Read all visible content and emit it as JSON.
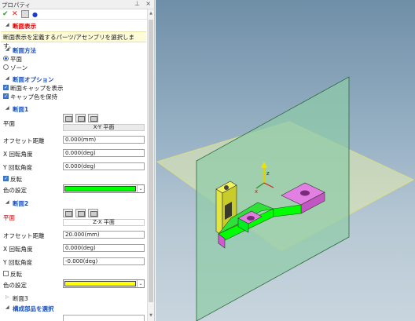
{
  "panel": {
    "title": "プロパティ",
    "pin_icon": "pin-icon",
    "close_icon": "close-icon",
    "toolbar": {
      "ok": "✔",
      "cancel": "✕",
      "dot": "●"
    }
  },
  "section_display": {
    "label": "断面表示",
    "description": "断面表示を定義するパーツ/アセンブリを選択します。"
  },
  "section_method": {
    "label": "断面方法",
    "options": [
      "平面",
      "ゾーン"
    ],
    "selected": "平面"
  },
  "section_options": {
    "label": "断面オプション",
    "show_cap": "断面キャップを表示",
    "keep_cap_color": "キャップ色を保持"
  },
  "section1": {
    "label": "断面1",
    "plane_label": "平面",
    "plane_value": "X-Y 平面",
    "offset_label": "オフセット距離",
    "offset_value": "0.000(mm)",
    "xrot_label": "X 回転角度",
    "xrot_value": "0.000(deg)",
    "yrot_label": "Y 回転角度",
    "yrot_value": "0.000(deg)",
    "flip_label": "反転",
    "color_label": "色の設定",
    "color": "#00ff00"
  },
  "section2": {
    "label": "断面2",
    "plane_label": "平面",
    "plane_value": "Z-X 平面",
    "offset_label": "オフセット距離",
    "offset_value": "20.000(mm)",
    "xrot_label": "X 回転角度",
    "xrot_value": "0.000(deg)",
    "yrot_label": "Y 回転角度",
    "yrot_value": "-0.000(deg)",
    "flip_label": "反転",
    "color_label": "色の設定",
    "color": "#ffff00"
  },
  "section3": {
    "label": "断面3"
  },
  "components": {
    "label": "構成部品を選択"
  },
  "viewport": {
    "axis_labels": {
      "x": "x",
      "z": "z"
    }
  }
}
